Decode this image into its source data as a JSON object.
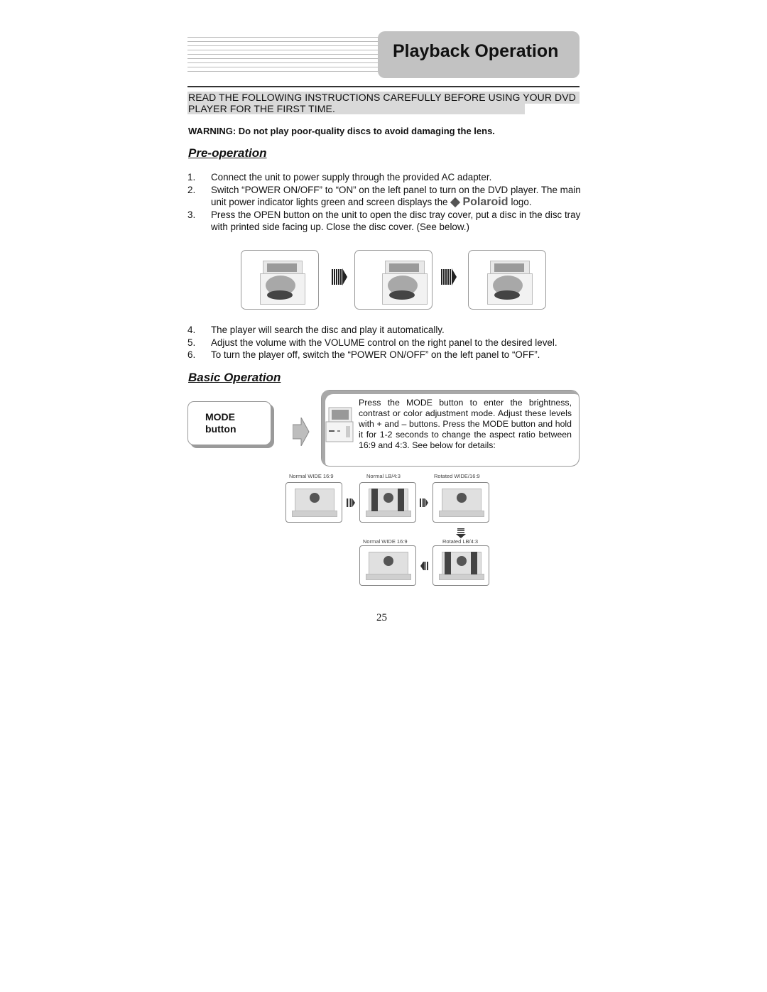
{
  "header": {
    "title": "Playback Operation"
  },
  "notice": "READ THE FOLLOWING INSTRUCTIONS CAREFULLY BEFORE USING YOUR DVD PLAYER FOR THE FIRST TIME.",
  "warning": "WARNING: Do not play poor-quality discs to avoid damaging the lens.",
  "pre_operation": {
    "heading": "Pre-operation",
    "steps_a": [
      {
        "num": "1.",
        "text": "Connect the unit to power supply through the provided AC adapter."
      },
      {
        "num": "2.",
        "text_before_logo": "Switch “POWER ON/OFF” to “ON” on the left panel to turn on the DVD player. The main unit power indicator lights green and screen displays the",
        "logo": "Polaroid",
        "text_after_logo": "logo."
      },
      {
        "num": "3.",
        "text": "Press the OPEN button on the unit to open the disc tray cover, put a disc in the disc tray with printed side facing up. Close the disc cover. (See below.)"
      }
    ],
    "steps_b": [
      {
        "num": "4.",
        "text": "The player will search the disc and play it automatically."
      },
      {
        "num": "5.",
        "text": "Adjust the volume with the VOLUME control on the right panel to the desired level."
      },
      {
        "num": "6.",
        "text": "To turn the player off, switch the “POWER ON/OFF” on the left panel to “OFF”."
      }
    ],
    "illustrations": [
      "open-disc-cover",
      "insert-disc",
      "close-disc-cover"
    ]
  },
  "basic_operation": {
    "heading": "Basic Operation",
    "mode_label_line1": "MODE",
    "mode_label_line2": "button",
    "description": "Press the MODE button to enter the brightness, contrast or color adjustment mode. Adjust these levels with + and – buttons. Press the MODE button and hold it for 1-2 seconds to change the aspect ratio between 16:9 and 4:3. See below for details:",
    "aspect_modes": [
      "Normal WIDE 16:9",
      "Normal LB/4:3",
      "Rotated WIDE/16:9",
      "Rotated LB/4:3",
      "Normal WIDE 16:9"
    ]
  },
  "page_number": "25"
}
